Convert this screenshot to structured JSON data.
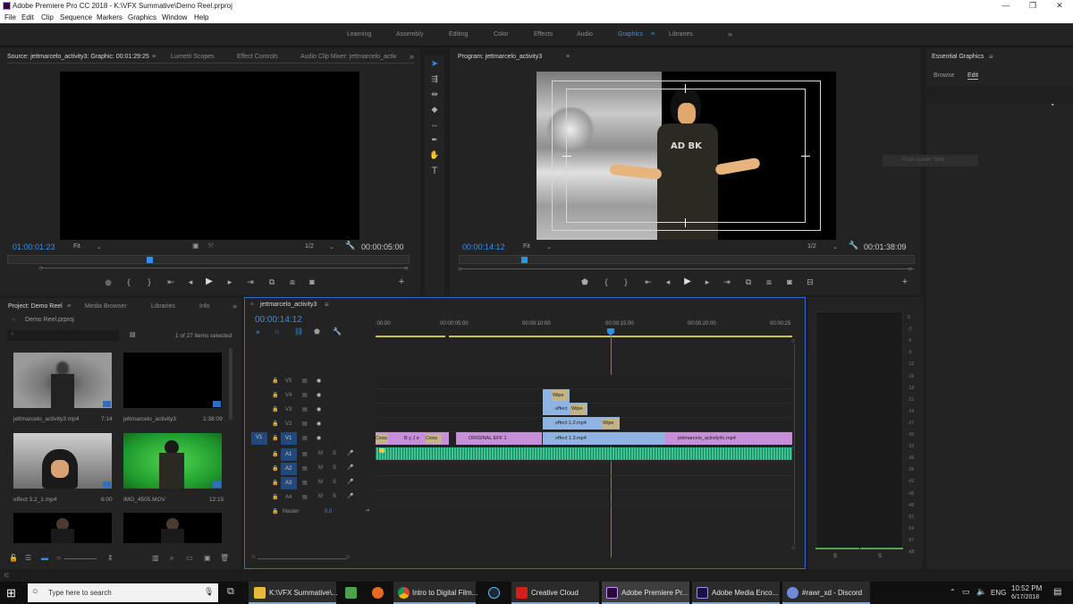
{
  "window": {
    "title": "Adobe Premiere Pro CC 2018 - K:\\VFX Summative\\Demo Reel.prproj",
    "minimize": "—",
    "maximize": "❐",
    "close": "✕"
  },
  "menu": [
    "File",
    "Edit",
    "Clip",
    "Sequence",
    "Markers",
    "Graphics",
    "Window",
    "Help"
  ],
  "workspaces": {
    "items": [
      "Learning",
      "Assembly",
      "Editing",
      "Color",
      "Effects",
      "Audio",
      "Graphics",
      "Libraries"
    ],
    "active": "Graphics",
    "more": "»"
  },
  "source": {
    "tabs": [
      "Source: jettmarcelo_activity3: Graphic: 00:01:29:25",
      "Lumetri Scopes",
      "Effect Controls",
      "Audio Clip Mixer: jettmarcelo_activ"
    ],
    "timecode": "01:00:01:23",
    "fit": "Fit",
    "resolution": "1/2",
    "duration": "00:00:05:00"
  },
  "program": {
    "tab": "Program: jettmarcelo_activity3",
    "timecode": "00:00:14:12",
    "fit": "Fit",
    "resolution": "1/2",
    "duration": "00:01:38:09",
    "shirt_text": "AD BK"
  },
  "essential_graphics": {
    "title": "Essential Graphics",
    "tabs": [
      "Browse",
      "Edit"
    ],
    "tooltip": "Push screen Strip"
  },
  "project": {
    "tabs": [
      "Project: Demo Reel",
      "Media Browser",
      "Libraries",
      "Info"
    ],
    "file": "Demo Reel.prproj",
    "selection": "1 of 27 items selected",
    "items": [
      {
        "name": "jettmarcelo_activity3.mp4",
        "duration": "7:14"
      },
      {
        "name": "jettmarcelo_activity3",
        "duration": "1:38:09"
      },
      {
        "name": "effect 3.2_1.mp4",
        "duration": "6:00"
      },
      {
        "name": "IMG_4505.MOV",
        "duration": "12:15"
      }
    ]
  },
  "timeline": {
    "tab": "jettmarcelo_activity3",
    "timecode": "00:00:14:12",
    "ruler": [
      ":00:00",
      "00:00:05:00",
      "00:00:10:00",
      "00:00:15:00",
      "00:00:20:00",
      "00:00:25"
    ],
    "video_tracks": [
      "V5",
      "V4",
      "V3",
      "V2",
      "V1"
    ],
    "audio_tracks": [
      "A1",
      "A2",
      "A3",
      "A4"
    ],
    "source_patch": "V1",
    "master": "Master",
    "master_value": "0.0",
    "clips": {
      "wipe_v4": "Wipe",
      "effect_v3": "effect",
      "wipe_v3": "Wipe",
      "effect_v2": "effect 1.2.mp4",
      "wipe_v2": "Wipe",
      "cross1": "Cross",
      "by_je": "B y  J e",
      "cross2": "Cross",
      "original": "ORIGINAL EFF 1",
      "effect13": "effect 1.3.mp4",
      "activity4": "jettmarcelo_activity4c.mp4"
    }
  },
  "meters": {
    "ticks": [
      "0",
      "-3",
      "-6",
      "-9",
      "-12",
      "-15",
      "-18",
      "-21",
      "-24",
      "-27",
      "-30",
      "-33",
      "-36",
      "-39",
      "-42",
      "-45",
      "-48",
      "-51",
      "-54",
      "-57",
      "-dB"
    ],
    "solo": "S"
  },
  "taskbar": {
    "search": "Type here to search",
    "apps": [
      "K:\\VFX Summative\\...",
      "Intro to Digital Film...",
      "Creative Cloud",
      "Adobe Premiere Pr...",
      "Adobe Media Enco...",
      "#rawr_xd - Discord"
    ],
    "lang": "ENG",
    "time": "10:52 PM",
    "date": "6/17/2018"
  }
}
